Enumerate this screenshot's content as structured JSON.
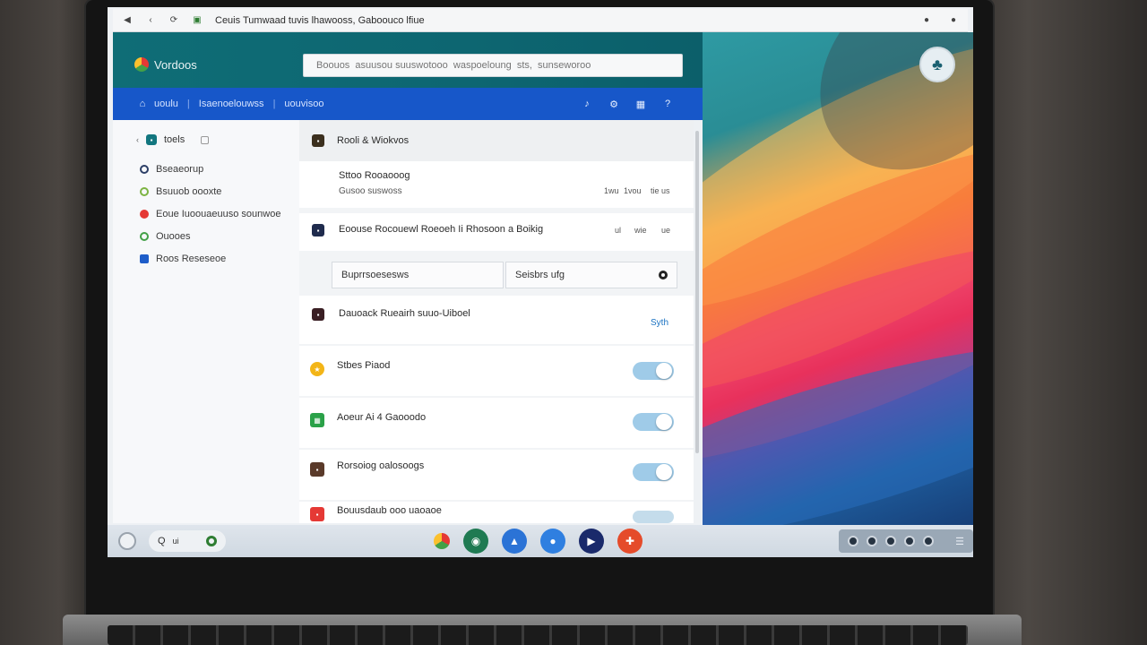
{
  "browser": {
    "url": "Ceuis  Tumwaad  tuvis lhawooss, Gaboouco lfiue"
  },
  "app": {
    "logo_text": "Vordoos",
    "search_placeholder": "Boouos  asuusou suuswotooo  waspoeloung  sts,  sunseworoo"
  },
  "nav": {
    "items": [
      "uoulu",
      "Isaenoelouwss",
      "uouvisoo"
    ],
    "separator": "|"
  },
  "sidebar": {
    "header": "toels",
    "items": [
      {
        "label": "Bseaeorup",
        "color": "#2c3e66"
      },
      {
        "label": "Bsuuob oooxte",
        "color": "#7cb342"
      },
      {
        "label": "Eoue Iuoouaeuuso  sounwoe",
        "color": "#e53935"
      },
      {
        "label": "Ouooes",
        "color": "#43a047"
      },
      {
        "label": "Roos  Reseseoe",
        "color": "#1e5dc9"
      }
    ]
  },
  "main": {
    "section_title": "Rooli & Wiokvos",
    "row1": {
      "title": "Sttoo Rooaooog",
      "subtitle": "Gusoo suswoss",
      "meta": [
        "1wu",
        "1vou",
        "tie  us"
      ]
    },
    "row2": {
      "title": "Eoouse Rocouewl Roeoeh Ii Rhosoon a Boikig",
      "meta": [
        "ul",
        "wie",
        "ue"
      ]
    },
    "input_left": "Buprrsoesesws",
    "input_right": "Seisbrs ufg",
    "row3": {
      "title": "Dauoack Rueairh suuo-Uiboel",
      "action": "Syth"
    },
    "toggles": [
      {
        "label": "Stbes Piaod",
        "color": "#f3b517",
        "state": "on"
      },
      {
        "label": "Aoeur Ai 4 Gaooodo",
        "color": "#2aa148",
        "state": "on"
      },
      {
        "label": "Rorsoiog  oalosoogs",
        "color": "#5a3a2a",
        "state": "on"
      },
      {
        "label": "Bouusdaub  ooo  uaoaoe",
        "color": "#e53935",
        "state": "on"
      }
    ]
  },
  "taskbar": {
    "search_text": "Q",
    "search_suffix": "ui"
  }
}
